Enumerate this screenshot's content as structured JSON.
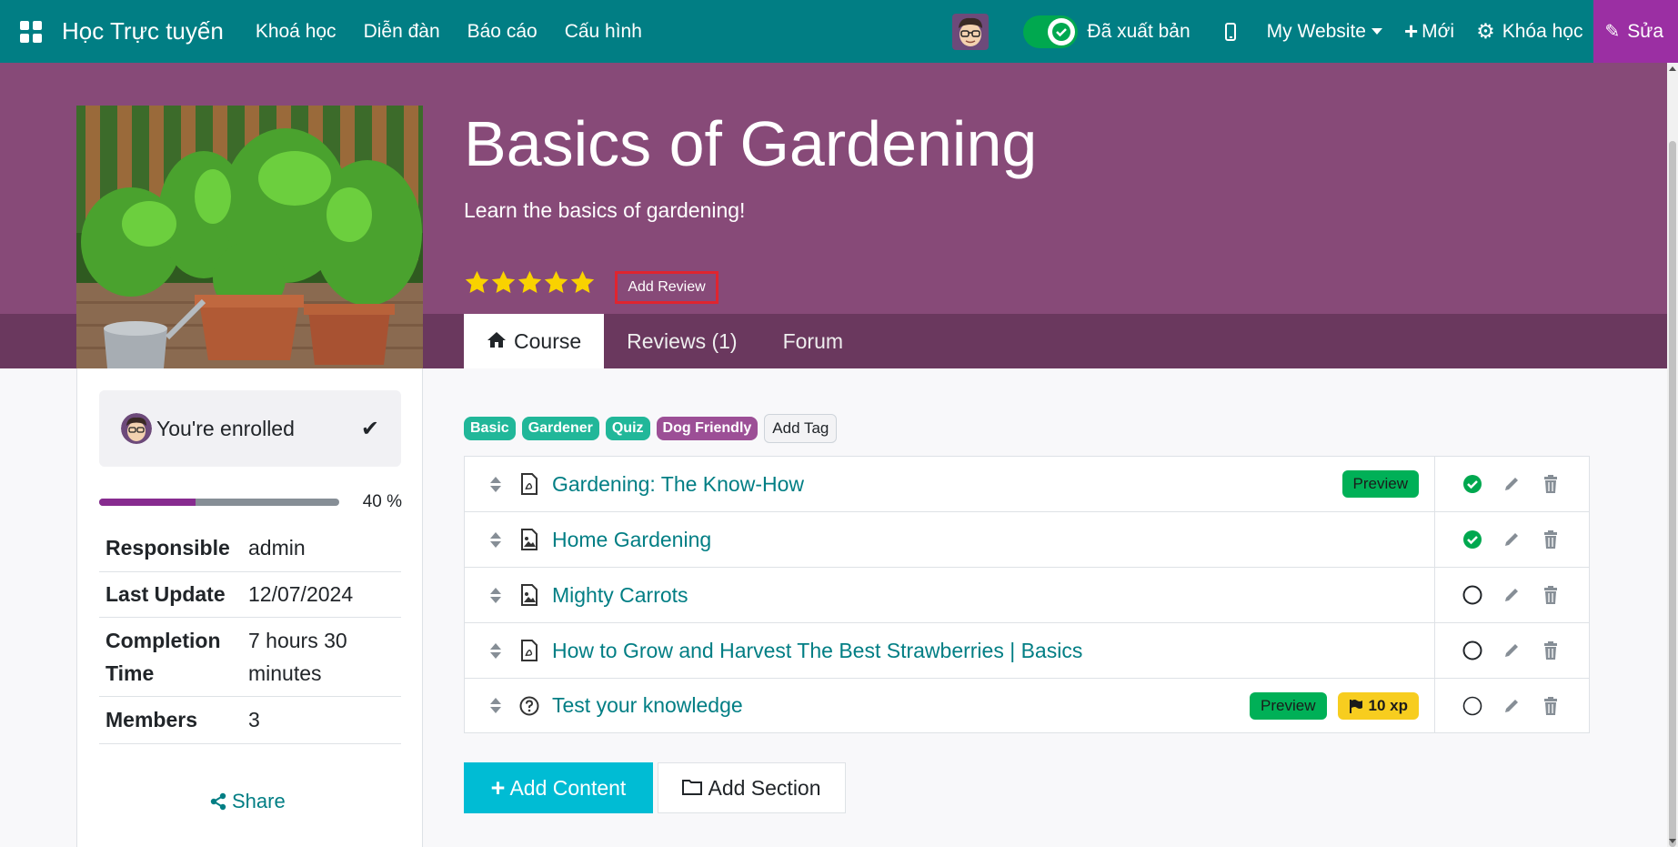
{
  "navbar": {
    "brand": "Học Trực tuyến",
    "menu": [
      "Khoá học",
      "Diễn đàn",
      "Báo cáo",
      "Cấu hình"
    ],
    "publish_label": "Đã xuất bản",
    "website": "My Website",
    "new_label": "Mới",
    "course_label": "Khóa học",
    "edit_label": "Sửa",
    "colors": {
      "bar": "#017e84",
      "edit": "#9b2fa3",
      "toggle": "#00a84f"
    }
  },
  "course": {
    "title": "Basics of Gardening",
    "subtitle": "Learn the basics of gardening!",
    "rating_stars": 5,
    "add_review_label": "Add Review",
    "tabs": [
      {
        "label": "Course",
        "icon": "home-icon",
        "active": true
      },
      {
        "label": "Reviews (1)",
        "active": false
      },
      {
        "label": "Forum",
        "active": false
      }
    ]
  },
  "sidebar": {
    "enrolled_text": "You're enrolled",
    "progress_percent": 40,
    "progress_label": "40 %",
    "info": [
      {
        "key": "Responsible",
        "value": "admin"
      },
      {
        "key": "Last Update",
        "value": "12/07/2024"
      },
      {
        "key": "Completion Time",
        "value": "7 hours 30 minutes"
      },
      {
        "key": "Members",
        "value": "3"
      }
    ],
    "share_label": "Share"
  },
  "tags": [
    {
      "label": "Basic",
      "color": "#21b799"
    },
    {
      "label": "Gardener",
      "color": "#21b799"
    },
    {
      "label": "Quiz",
      "color": "#21b799"
    },
    {
      "label": "Dog Friendly",
      "color": "#9c4f96"
    }
  ],
  "add_tag_label": "Add Tag",
  "lessons": [
    {
      "title": "Gardening: The Know-How",
      "icon": "pdf-icon",
      "preview": "Preview",
      "xp": "",
      "done": true
    },
    {
      "title": "Home Gardening",
      "icon": "image-icon",
      "preview": "",
      "xp": "",
      "done": true
    },
    {
      "title": "Mighty Carrots",
      "icon": "image-icon",
      "preview": "",
      "xp": "",
      "done": false
    },
    {
      "title": "How to Grow and Harvest The Best Strawberries | Basics",
      "icon": "pdf-icon",
      "preview": "",
      "xp": "",
      "done": false
    },
    {
      "title": "Test your knowledge",
      "icon": "quiz-icon",
      "preview": "Preview",
      "xp": "10 xp",
      "done": false
    }
  ],
  "buttons": {
    "add_content": "Add Content",
    "add_section": "Add Section"
  }
}
